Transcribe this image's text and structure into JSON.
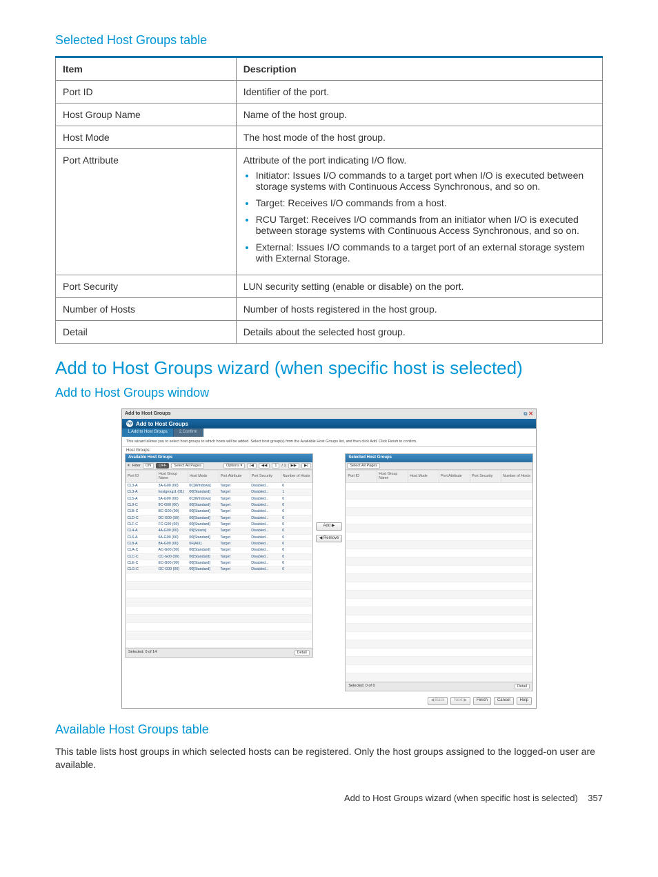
{
  "sections": {
    "selected_table_title": "Selected Host Groups table",
    "wizard_title": "Add to Host Groups wizard (when specific host is selected)",
    "window_title": "Add to Host Groups window",
    "available_table_title": "Available Host Groups table",
    "available_table_text": "This table lists host groups in which selected hosts can be registered. Only the host groups assigned to the logged-on user are available."
  },
  "desc_table": {
    "headers": {
      "item": "Item",
      "desc": "Description"
    },
    "rows": [
      {
        "item": "Port ID",
        "desc": "Identifier of the port."
      },
      {
        "item": "Host Group Name",
        "desc": "Name of the host group."
      },
      {
        "item": "Host Mode",
        "desc": "The host mode of the host group."
      },
      {
        "item": "Port Attribute",
        "desc": "Attribute of the port indicating I/O flow.",
        "bullets": [
          "Initiator: Issues I/O commands to a target port when I/O is executed between storage systems with Continuous Access Synchronous, and so on.",
          "Target: Receives I/O commands from a host.",
          "RCU Target: Receives I/O commands from an initiator when I/O is executed between storage systems with Continuous Access Synchronous, and so on.",
          "External: Issues I/O commands to a target port of an external storage system with External Storage."
        ]
      },
      {
        "item": "Port Security",
        "desc": "LUN security setting (enable or disable) on the port."
      },
      {
        "item": "Number of Hosts",
        "desc": "Number of hosts registered in the host group."
      },
      {
        "item": "Detail",
        "desc": "Details about the selected host group."
      }
    ]
  },
  "shot": {
    "titlebar": "Add to Host Groups",
    "band": "Add to Host Groups",
    "steps": {
      "s1": "1.Add to Host Groups",
      "s2": "2.Confirm"
    },
    "helptext": "This wizard allows you to select host groups to which hosts will be added. Select host group(s) from the Available Host Groups list, and then click Add. Click Finish to confirm.",
    "groups_label": "Host Groups:",
    "left": {
      "title": "Available Host Groups",
      "filter_label": "Filter",
      "on": "ON",
      "off": "OFF",
      "select_all": "Select All Pages",
      "options": "Options ▾",
      "page_first": "|◀",
      "page_prev": "◀◀",
      "page_cur": "1",
      "page_sep": "/ 1",
      "page_next": "▶▶",
      "page_last": "▶|",
      "cols": [
        "Port ID",
        "Host Group Name",
        "Host Mode",
        "Port Attribute",
        "Port Security",
        "Number of Hosts"
      ],
      "rows": [
        [
          "CL3-A",
          "3A-G00 (00)",
          "0C[Windows]",
          "Target",
          "Disabled...",
          "0"
        ],
        [
          "CL3-A",
          "hostgroup1 (01)",
          "00[Standard]",
          "Target",
          "Disabled...",
          "1"
        ],
        [
          "CL5-A",
          "5A-G00 (00)",
          "0C[Windows]",
          "Target",
          "Disabled...",
          "0"
        ],
        [
          "CL9-C",
          "9C-G00 (00)",
          "00[Standard]",
          "Target",
          "Disabled...",
          "0"
        ],
        [
          "CLB-C",
          "BC-G00 (00)",
          "00[Standard]",
          "Target",
          "Disabled...",
          "0"
        ],
        [
          "CLD-C",
          "DC-G00 (00)",
          "00[Standard]",
          "Target",
          "Disabled...",
          "0"
        ],
        [
          "CLF-C",
          "FC-G00 (00)",
          "00[Standard]",
          "Target",
          "Disabled...",
          "0"
        ],
        [
          "CL4-A",
          "4A-G00 (00)",
          "09[Solaris]",
          "Target",
          "Disabled...",
          "0"
        ],
        [
          "CL6-A",
          "6A-G00 (00)",
          "00[Standard]",
          "Target",
          "Disabled...",
          "0"
        ],
        [
          "CL8-A",
          "8A-G00 (00)",
          "0F[AIX]",
          "Target",
          "Disabled...",
          "0"
        ],
        [
          "CLA-C",
          "AC-G00 (00)",
          "00[Standard]",
          "Target",
          "Disabled...",
          "0"
        ],
        [
          "CLC-C",
          "CC-G00 (00)",
          "00[Standard]",
          "Target",
          "Disabled...",
          "0"
        ],
        [
          "CLE-C",
          "EC-G00 (00)",
          "00[Standard]",
          "Target",
          "Disabled...",
          "0"
        ],
        [
          "CLG-C",
          "GC-G00 (00)",
          "00[Standard]",
          "Target",
          "Disabled...",
          "0"
        ]
      ],
      "selected": "Selected: 0  of 14",
      "detail": "Detail"
    },
    "mid": {
      "add": "Add ▶",
      "remove": "◀ Remove"
    },
    "right": {
      "title": "Selected Host Groups",
      "select_all": "Select All Pages",
      "cols": [
        "Port ID",
        "Host Group Name",
        "Host Mode",
        "Port Attribute",
        "Port Security",
        "Number of Hosts"
      ],
      "selected": "Selected: 0  of 0",
      "detail": "Detail"
    },
    "footer": {
      "back": "◀ Back",
      "next": "Next ▶",
      "finish": "Finish",
      "cancel": "Cancel",
      "help": "Help"
    }
  },
  "footer": {
    "text": "Add to Host Groups wizard (when specific host is selected)",
    "page": "357"
  }
}
